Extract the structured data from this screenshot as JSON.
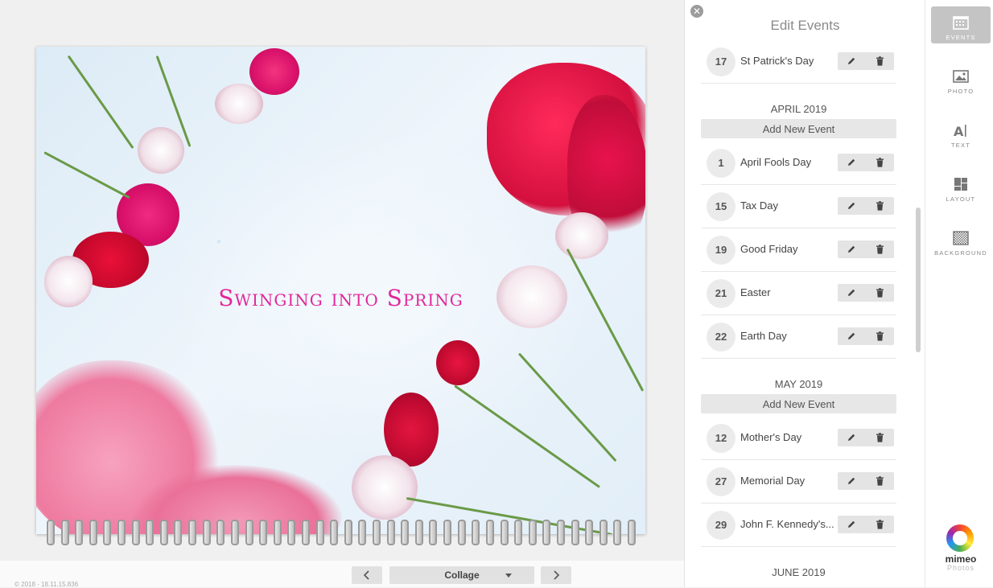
{
  "cover": {
    "title": "Swinging into Spring"
  },
  "bottom_bar": {
    "copyright": "© 2018 - 18.11.15.836",
    "layout_select": "Collage",
    "prev_icon": "chevron-left-icon",
    "next_icon": "chevron-right-icon"
  },
  "panel": {
    "title": "Edit Events",
    "close_icon": "close-icon",
    "add_label": "Add New Event",
    "sections": [
      {
        "month": "",
        "add": false,
        "events": [
          {
            "day": "17",
            "name": "St Patrick's Day"
          }
        ]
      },
      {
        "month": "APRIL 2019",
        "add": true,
        "events": [
          {
            "day": "1",
            "name": "April Fools Day"
          },
          {
            "day": "15",
            "name": "Tax Day"
          },
          {
            "day": "19",
            "name": "Good Friday"
          },
          {
            "day": "21",
            "name": "Easter"
          },
          {
            "day": "22",
            "name": "Earth Day"
          }
        ]
      },
      {
        "month": "MAY 2019",
        "add": true,
        "events": [
          {
            "day": "12",
            "name": "Mother's Day"
          },
          {
            "day": "27",
            "name": "Memorial Day"
          },
          {
            "day": "29",
            "name": "John F. Kennedy's..."
          }
        ]
      },
      {
        "month": "JUNE 2019",
        "add": false,
        "events": []
      }
    ]
  },
  "toolbar": {
    "tools": [
      {
        "label": "EVENTS",
        "icon": "calendar-icon",
        "active": true
      },
      {
        "label": "PHOTO",
        "icon": "image-icon",
        "active": false
      },
      {
        "label": "TEXT",
        "icon": "text-icon",
        "active": false
      },
      {
        "label": "LAYOUT",
        "icon": "layout-icon",
        "active": false
      },
      {
        "label": "BACKGROUND",
        "icon": "background-icon",
        "active": false
      }
    ]
  },
  "brand": {
    "name": "mimeo",
    "sub": "Photos",
    "accent": "#e2279a"
  }
}
